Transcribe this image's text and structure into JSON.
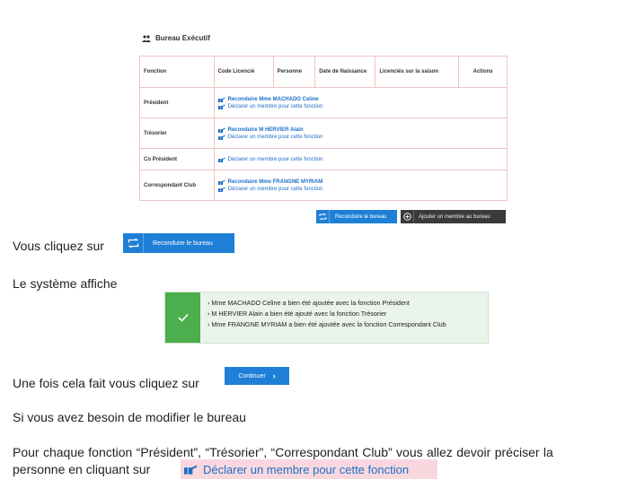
{
  "bureau": {
    "title": "Bureau Exécutif",
    "icon": "group-icon",
    "headers": [
      "Fonction",
      "Code Licencié",
      "Personne",
      "Date de Naissance",
      "Licenciés sur la saison",
      "Actions"
    ],
    "rows": [
      {
        "fonction": "Président",
        "links": [
          {
            "text": "Reconduire Mme MACHADO Celine",
            "bold": true
          },
          {
            "text": "Déclarer un membre pour cette fonction",
            "bold": false
          }
        ]
      },
      {
        "fonction": "Trésorier",
        "links": [
          {
            "text": "Reconduire M HERVIER Alain",
            "bold": true
          },
          {
            "text": "Déclarer un membre pour cette fonction",
            "bold": false
          }
        ]
      },
      {
        "fonction": "Co Président",
        "links": [
          {
            "text": "Déclarer un membre pour cette fonction",
            "bold": false
          }
        ]
      },
      {
        "fonction": "Correspondant Club",
        "links": [
          {
            "text": "Reconduire Mme FRANGNE MYRIAM",
            "bold": true
          },
          {
            "text": "Déclarer un membre pour cette fonction",
            "bold": false
          }
        ]
      }
    ],
    "reconduire_button": "Reconduire le bureau",
    "add_member_button": "Ajouter un membre au bureau"
  },
  "doc": {
    "vous_cliquez": "Vous cliquez sur",
    "reconduire_big": "Reconduire le bureau",
    "systeme_affiche": "Le système affiche",
    "messages": [
      "Mme MACHADO Celine a bien été ajoutée avec la fonction Président",
      "M HERVIER Alain a bien été ajouté avec la fonction Trésorier",
      "Mme FRANGNE MYRIAM a bien été ajoutée avec la fonction Correspondant Club"
    ],
    "une_fois": "Une fois cela fait vous cliquez sur",
    "continuer": "Continuer",
    "si_vous": "Si vous avez besoin de modifier le bureau",
    "pour_chaque_line1": "Pour chaque fonction “Président”, “Trésorier”, “Correspondant Club” vous allez devoir préciser la",
    "pour_chaque_line2": "personne en cliquant sur",
    "declarer_link": "Déclarer un membre pour cette fonction"
  },
  "colors": {
    "accent": "#1f7fd6",
    "success": "#4cae4c",
    "link": "#1e6ec8",
    "highlight": "#f8d8de"
  }
}
